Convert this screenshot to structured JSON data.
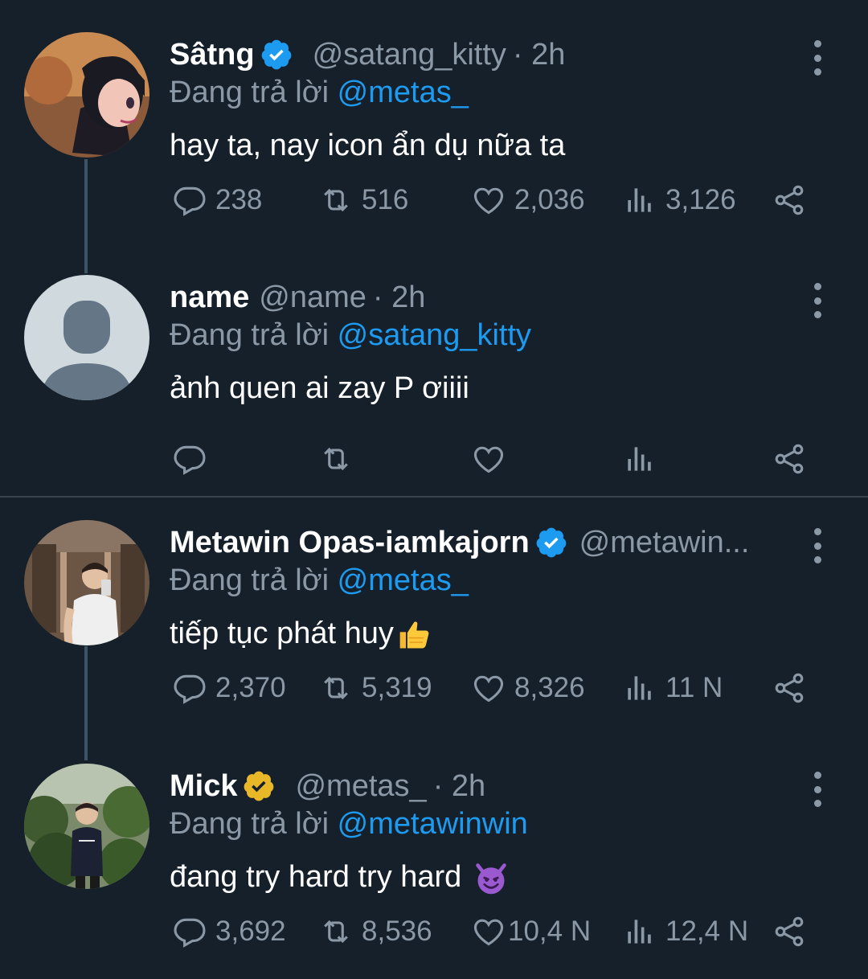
{
  "reply_prefix": "Đang trả lời",
  "colors": {
    "background": "#15202b",
    "muted": "#8b98a5",
    "mention": "#1d9bf0",
    "verified_blue": "#1d9bf0",
    "verified_gold": "#e8b829"
  },
  "tweets": [
    {
      "name": "Sâtng",
      "badge": "verified-blue-badge",
      "handle": "@satang_kitty",
      "time": "· 2h",
      "reply_to": "@metas_",
      "text": "hay ta, nay icon ẩn dụ nữa ta",
      "replies": "238",
      "retweets": "516",
      "likes": "2,036",
      "views": "3,126",
      "avatar": "cartoon-avatar"
    },
    {
      "name": "name",
      "badge": "",
      "handle": "@name",
      "time": "· 2h",
      "reply_to": "@satang_kitty",
      "text": "ảnh quen ai zay P ơiiii",
      "replies": "",
      "retweets": "",
      "likes": "",
      "views": "",
      "avatar": "default-avatar"
    },
    {
      "name": "Metawin Opas-iamkajorn",
      "badge": "verified-blue-badge",
      "handle": "@metawin...",
      "time": "",
      "reply_to": "@metas_",
      "text": "tiếp tục phát huy",
      "emoji": "thumbs-up-emoji",
      "replies": "2,370",
      "retweets": "5,319",
      "likes": "8,326",
      "views": "11 N",
      "avatar": "photo-avatar"
    },
    {
      "name": "Mick",
      "badge": "verified-gold-badge",
      "handle": "@metas_",
      "time": "· 2h",
      "reply_to": "@metawinwin",
      "text": "đang try hard try hard ",
      "emoji": "smiling-devil-emoji",
      "replies": "3,692",
      "retweets": "8,536",
      "likes": "10,4 N",
      "views": "12,4 N",
      "avatar": "photo-avatar"
    }
  ]
}
